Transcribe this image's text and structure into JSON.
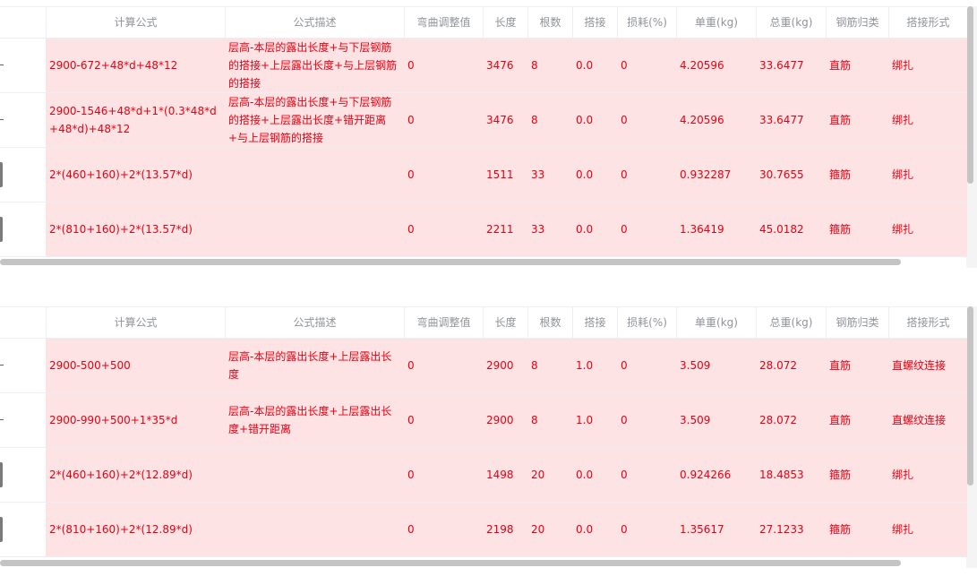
{
  "headers": [
    "计算公式",
    "公式描述",
    "弯曲调整值",
    "长度",
    "根数",
    "搭接",
    "损耗(%)",
    "单重(kg)",
    "总重(kg)",
    "钢筋归类",
    "搭接形式"
  ],
  "tables": [
    {
      "rows": [
        {
          "lead": "dash",
          "formula": "2900-672+48*d+48*12",
          "desc": "层高-本层的露出长度+与下层钢筋的搭接+上层露出长度+与上层钢筋的搭接",
          "bend": "0",
          "length": "3476",
          "count": "8",
          "lap": "0.0",
          "loss": "0",
          "unit_w": "4.20596",
          "total_w": "33.6477",
          "category": "直筋",
          "lap_type": "绑扎"
        },
        {
          "lead": "dash",
          "formula": "2900-1546+48*d+1*(0.3*48*d+48*d)+48*12",
          "desc": "层高-本层的露出长度+与下层钢筋的搭接+上层露出长度+错开距离+与上层钢筋的搭接",
          "bend": "0",
          "length": "3476",
          "count": "8",
          "lap": "0.0",
          "loss": "0",
          "unit_w": "4.20596",
          "total_w": "33.6477",
          "category": "直筋",
          "lap_type": "绑扎"
        },
        {
          "lead": "button",
          "formula": "2*(460+160)+2*(13.57*d)",
          "desc": "",
          "bend": "0",
          "length": "1511",
          "count": "33",
          "lap": "0.0",
          "loss": "0",
          "unit_w": "0.932287",
          "total_w": "30.7655",
          "category": "箍筋",
          "lap_type": "绑扎"
        },
        {
          "lead": "button",
          "formula": "2*(810+160)+2*(13.57*d)",
          "desc": "",
          "bend": "0",
          "length": "2211",
          "count": "33",
          "lap": "0.0",
          "loss": "0",
          "unit_w": "1.36419",
          "total_w": "45.0182",
          "category": "箍筋",
          "lap_type": "绑扎"
        }
      ]
    },
    {
      "rows": [
        {
          "lead": "dash",
          "formula": "2900-500+500",
          "desc": "层高-本层的露出长度+上层露出长度",
          "bend": "0",
          "length": "2900",
          "count": "8",
          "lap": "1.0",
          "loss": "0",
          "unit_w": "3.509",
          "total_w": "28.072",
          "category": "直筋",
          "lap_type": "直螺纹连接"
        },
        {
          "lead": "dash",
          "formula": "2900-990+500+1*35*d",
          "desc": "层高-本层的露出长度+上层露出长度+错开距离",
          "bend": "0",
          "length": "2900",
          "count": "8",
          "lap": "1.0",
          "loss": "0",
          "unit_w": "3.509",
          "total_w": "28.072",
          "category": "直筋",
          "lap_type": "直螺纹连接"
        },
        {
          "lead": "button",
          "formula": "2*(460+160)+2*(12.89*d)",
          "desc": "",
          "bend": "0",
          "length": "1498",
          "count": "20",
          "lap": "0.0",
          "loss": "0",
          "unit_w": "0.924266",
          "total_w": "18.4853",
          "category": "箍筋",
          "lap_type": "绑扎"
        },
        {
          "lead": "button",
          "formula": "2*(810+160)+2*(12.89*d)",
          "desc": "",
          "bend": "0",
          "length": "2198",
          "count": "20",
          "lap": "0.0",
          "loss": "0",
          "unit_w": "1.35617",
          "total_w": "27.1233",
          "category": "箍筋",
          "lap_type": "绑扎"
        }
      ]
    }
  ]
}
